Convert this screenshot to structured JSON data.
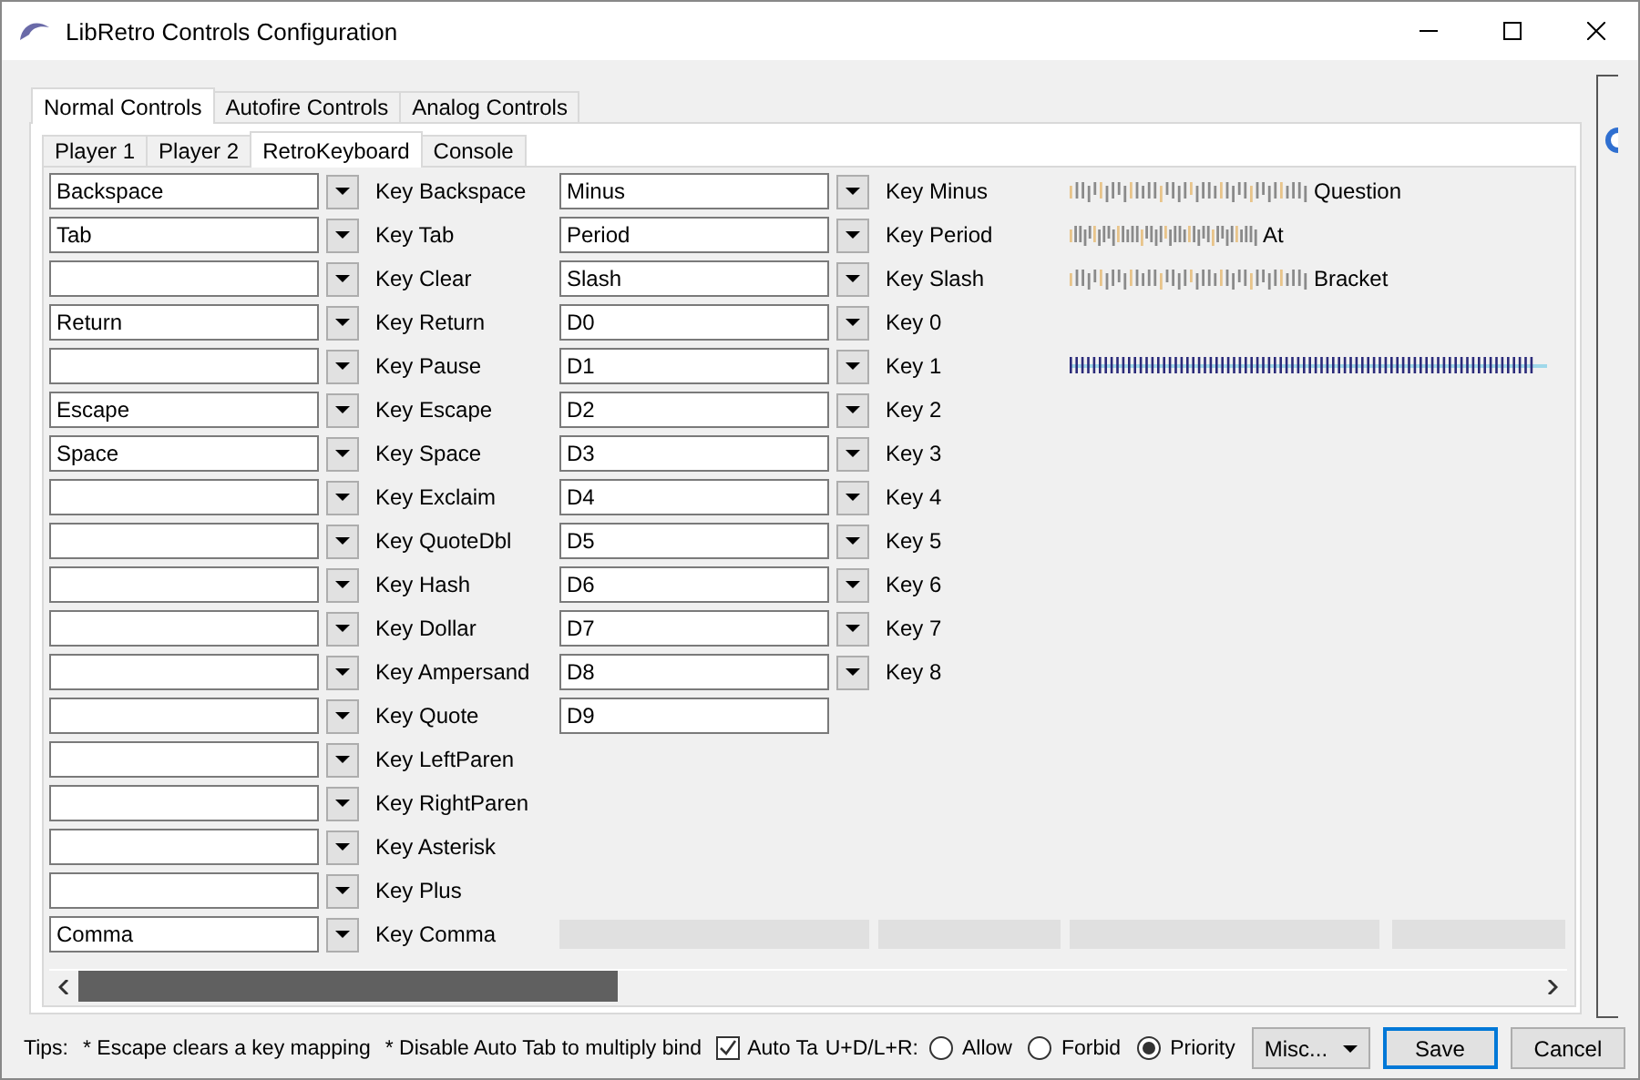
{
  "window": {
    "title": "LibRetro Controls Configuration"
  },
  "outer_tabs": [
    {
      "label": "Normal Controls",
      "selected": true
    },
    {
      "label": "Autofire Controls",
      "selected": false
    },
    {
      "label": "Analog Controls",
      "selected": false
    }
  ],
  "inner_tabs": [
    {
      "label": "Player 1",
      "selected": false
    },
    {
      "label": "Player 2",
      "selected": false
    },
    {
      "label": "RetroKeyboard",
      "selected": true
    },
    {
      "label": "Console",
      "selected": false
    }
  ],
  "columns": [
    {
      "bindings": [
        {
          "kind": "combo",
          "value": "Backspace",
          "label": "Key Backspace"
        },
        {
          "kind": "combo",
          "value": "Tab",
          "label": "Key Tab"
        },
        {
          "kind": "combo",
          "label": "Key Clear"
        },
        {
          "kind": "combo",
          "value": "Return",
          "label": "Key Return"
        },
        {
          "kind": "combo",
          "label": "Key Pause"
        },
        {
          "kind": "combo",
          "value": "Escape",
          "label": "Key Escape"
        },
        {
          "kind": "combo",
          "value": "Space",
          "label": "Key Space"
        },
        {
          "kind": "combo",
          "label": "Key Exclaim"
        },
        {
          "kind": "combo",
          "label": "Key QuoteDbl"
        },
        {
          "kind": "combo",
          "label": "Key Hash"
        },
        {
          "kind": "combo",
          "label": "Key Dollar"
        },
        {
          "kind": "combo",
          "label": "Key Ampersand"
        },
        {
          "kind": "combo",
          "label": "Key Quote"
        },
        {
          "kind": "combo",
          "label": "Key LeftParen"
        },
        {
          "kind": "combo",
          "label": "Key RightParen"
        },
        {
          "kind": "combo",
          "label": "Key Asterisk"
        },
        {
          "kind": "combo",
          "label": "Key Plus"
        },
        {
          "kind": "combo",
          "value": "Comma",
          "label": "Key Comma"
        }
      ]
    },
    {
      "bindings": [
        {
          "kind": "combo",
          "value": "Minus",
          "label": "Key Minus"
        },
        {
          "kind": "combo",
          "value": "Period",
          "label": "Key Period"
        },
        {
          "kind": "combo",
          "value": "Slash",
          "label": "Key Slash"
        },
        {
          "kind": "combo",
          "value": "D0",
          "label": "Key 0"
        },
        {
          "kind": "combo",
          "value": "D1",
          "label": "Key 1"
        },
        {
          "kind": "combo",
          "value": "D2",
          "label": "Key 2"
        },
        {
          "kind": "combo",
          "value": "D3",
          "label": "Key 3"
        },
        {
          "kind": "combo",
          "value": "D4",
          "label": "Key 4"
        },
        {
          "kind": "combo",
          "value": "D5",
          "label": "Key 5"
        },
        {
          "kind": "combo",
          "value": "D6",
          "label": "Key 6"
        },
        {
          "kind": "combo",
          "value": "D7",
          "label": "Key 7"
        },
        {
          "kind": "combo",
          "value": "D8",
          "label": "Key 8"
        },
        {
          "kind": "text",
          "value": "D9"
        }
      ]
    }
  ],
  "column_3": [
    {
      "kind": "label",
      "text": "Question"
    },
    {
      "kind": "label",
      "text": "At"
    },
    {
      "kind": "label",
      "text": "Bracket"
    },
    {
      "kind": "blank"
    },
    {
      "kind": "bars"
    }
  ],
  "tips": {
    "label": "Tips:",
    "items": [
      "* Escape clears a key mapping",
      "* Disable Auto Tab to multiply bind"
    ]
  },
  "auto_tab": {
    "label": "Auto Ta",
    "checked": true
  },
  "diagonal": {
    "label": "U+D/L+R:",
    "options": [
      {
        "label": "Allow",
        "selected": false
      },
      {
        "label": "Forbid",
        "selected": false
      },
      {
        "label": "Priority",
        "selected": true
      }
    ]
  },
  "buttons": [
    {
      "kind": "menu",
      "label": "Misc..."
    },
    {
      "kind": "default",
      "label": "Save"
    },
    {
      "kind": "plain",
      "label": "Cancel"
    }
  ]
}
